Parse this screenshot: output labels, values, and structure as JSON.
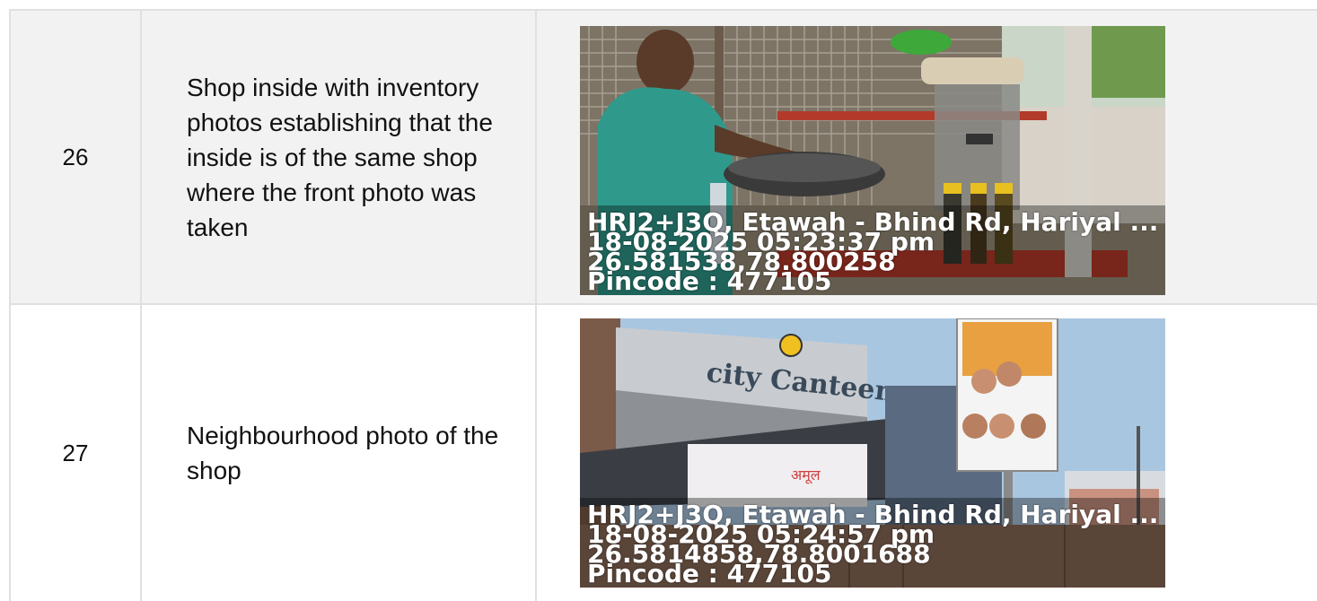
{
  "rows": [
    {
      "number": "26",
      "description": "Shop inside with inventory photos establishing that the inside is of the same shop where the front photo was taken",
      "stamp": {
        "address": "HRJ2+J3Q, Etawah - Bhind Rd, Hariyal ...",
        "datetime": "18-08-2025 05:23:37 pm",
        "coords": "26.581538,78.800258",
        "pincode": "Pincode : 477105"
      }
    },
    {
      "number": "27",
      "description": "Neighbourhood photo of the shop",
      "stamp": {
        "address": "HRJ2+J3Q, Etawah - Bhind Rd, Hariyal ...",
        "datetime": "18-08-2025 05:24:57 pm",
        "coords": "26.5814858,78.8001688",
        "pincode": "Pincode : 477105"
      }
    }
  ],
  "photo_signs": {
    "shop_name": "city Canteen"
  }
}
